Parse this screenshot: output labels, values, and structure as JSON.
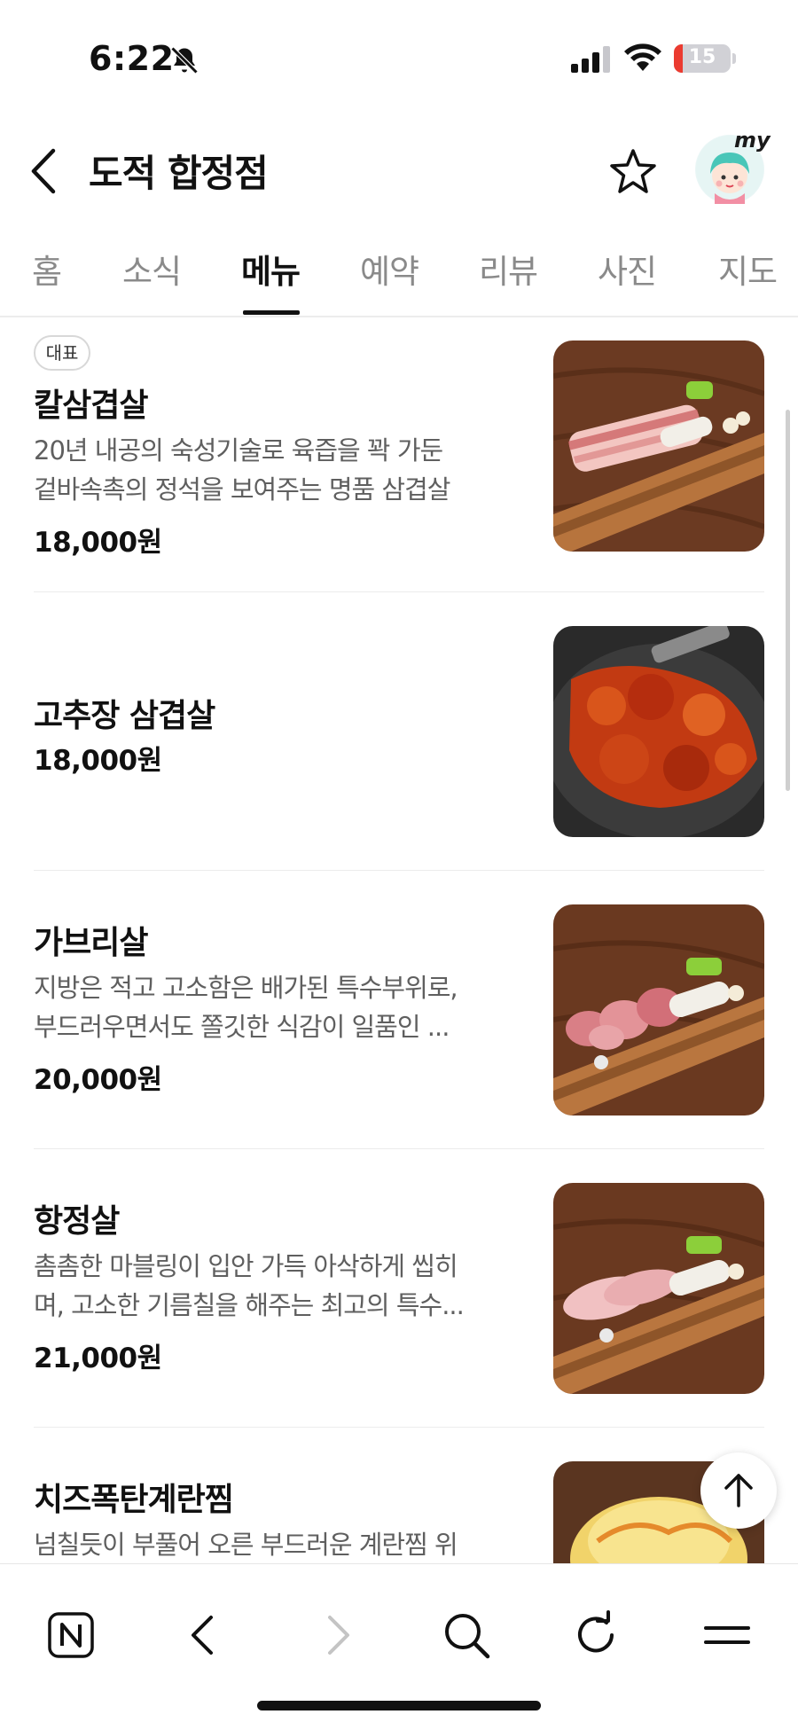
{
  "status_bar": {
    "time": "6:22",
    "battery_level": "15",
    "battery_fraction": 0.15
  },
  "header": {
    "title": "도적 합정점",
    "avatar_badge": "my"
  },
  "tabs": [
    {
      "label": "홈"
    },
    {
      "label": "소식"
    },
    {
      "label": "메뉴",
      "active": true
    },
    {
      "label": "예약"
    },
    {
      "label": "리뷰"
    },
    {
      "label": "사진"
    },
    {
      "label": "지도"
    }
  ],
  "menu": {
    "items": [
      {
        "badge": "대표",
        "name": "칼삼겹살",
        "desc_lines": [
          "20년 내공의 숙성기술로 육즙을 꽉 가둔",
          "겉바속촉의 정석을 보여주는 명품 삼겹살"
        ],
        "price": "18,000원",
        "image": "pork-belly-board-photo"
      },
      {
        "name": "고추장 삼겹살",
        "desc_lines": [],
        "price": "18,000원",
        "image": "spicy-pork-grill-photo"
      },
      {
        "name": "가브리살",
        "desc_lines": [
          "지방은 적고 고소함은 배가된 특수부위로,",
          "부드러우면서도 쫄깃한 식감이 일품인 ..."
        ],
        "price": "20,000원",
        "image": "gabrisal-board-photo"
      },
      {
        "name": "항정살",
        "desc_lines": [
          "촘촘한 마블링이 입안 가득 아삭하게 씹히",
          "며, 고소한 기름칠을 해주는 최고의 특수..."
        ],
        "price": "21,000원",
        "image": "hangjeongsal-board-photo"
      },
      {
        "name": "치즈폭탄계란찜",
        "desc_lines": [
          "넘칠듯이 부풀어 오른 부드러운 계란찜 위"
        ],
        "price": "",
        "image": "cheese-egg-photo"
      }
    ]
  },
  "colors": {
    "accent_text": "#111111",
    "inactive_tab": "#8a8a8a",
    "desc_text": "#5f5f5f",
    "battery_low": "#eb3b30"
  }
}
